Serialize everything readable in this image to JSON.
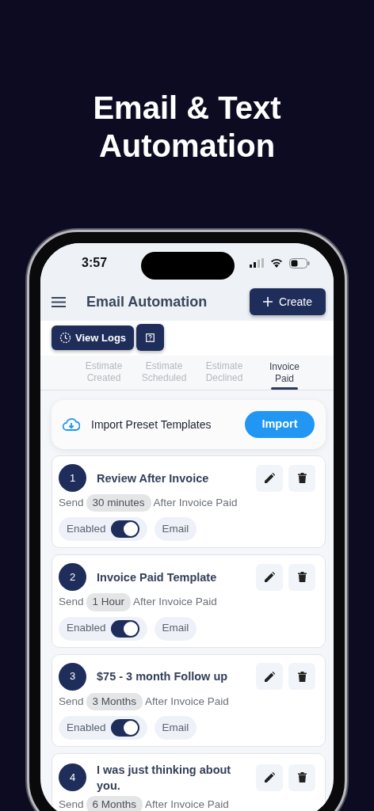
{
  "headline_lines": [
    "Email & Text",
    "Automation"
  ],
  "status_bar": {
    "time": "3:57"
  },
  "header": {
    "title": "Email Automation",
    "create_button": "Create"
  },
  "toolbar": {
    "view_logs_button": "View Logs"
  },
  "tabs": [
    {
      "label": "Estimate Created",
      "selected": false
    },
    {
      "label": "Estimate Scheduled",
      "selected": false
    },
    {
      "label": "Estimate Declined",
      "selected": false
    },
    {
      "label": "Invoice Paid",
      "selected": true
    }
  ],
  "import_card": {
    "text": "Import Preset Templates",
    "button": "Import"
  },
  "templates": [
    {
      "number": "1",
      "title": "Review After Invoice",
      "send_label": "Send",
      "delay": "30 minutes",
      "trigger": "After Invoice Paid",
      "status_label": "Enabled",
      "enabled": true,
      "channel": "Email"
    },
    {
      "number": "2",
      "title": "Invoice Paid Template",
      "send_label": "Send",
      "delay": "1 Hour",
      "trigger": "After Invoice Paid",
      "status_label": "Enabled",
      "enabled": true,
      "channel": "Email"
    },
    {
      "number": "3",
      "title": "$75 - 3 month Follow up",
      "send_label": "Send",
      "delay": "3 Months",
      "trigger": "After Invoice Paid",
      "status_label": "Enabled",
      "enabled": true,
      "channel": "Email"
    },
    {
      "number": "4",
      "title": "I was just thinking about you.",
      "send_label": "Send",
      "delay": "6 Months",
      "trigger": "After Invoice Paid"
    }
  ]
}
